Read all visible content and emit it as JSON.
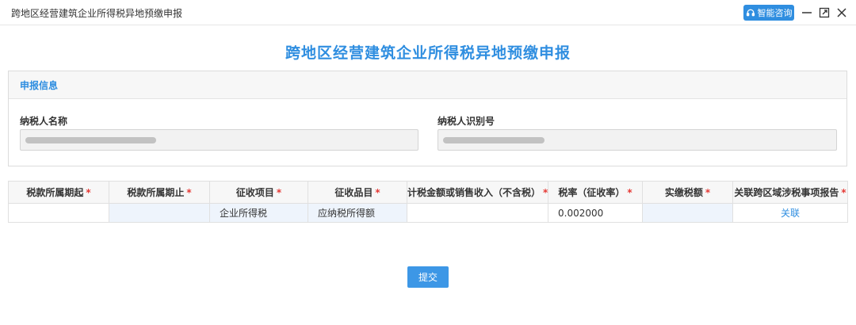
{
  "window": {
    "title": "跨地区经营建筑企业所得税异地预缴申报",
    "assist_label": "智能咨询",
    "icons": {
      "assist": "headset-icon",
      "minimize": "minimize-icon",
      "maximize": "maximize-icon",
      "close": "close-icon"
    }
  },
  "page": {
    "heading": "跨地区经营建筑企业所得税异地预缴申报"
  },
  "info_panel": {
    "header": "申报信息",
    "taxpayer_name": {
      "label": "纳税人名称",
      "value": ""
    },
    "taxpayer_id": {
      "label": "纳税人识别号",
      "value": ""
    }
  },
  "table": {
    "columns": [
      "税款所属期起",
      "税款所属期止",
      "征收项目",
      "征收品目",
      "计税金额或销售收入（不含税）",
      "税率（征收率）",
      "实缴税额",
      "关联跨区域涉税事项报告"
    ],
    "required_mark": "*",
    "row": {
      "period_start": "",
      "period_end": "",
      "tax_item": "企业所得税",
      "tax_category": "应纳税所得额",
      "taxable_amount": "",
      "tax_rate": "0.002000",
      "paid_tax": "",
      "link_label": "关联"
    }
  },
  "actions": {
    "submit_label": "提交"
  },
  "colors": {
    "accent": "#2f8ee0",
    "required": "#e53935",
    "editable_cell": "#eef4fc"
  }
}
